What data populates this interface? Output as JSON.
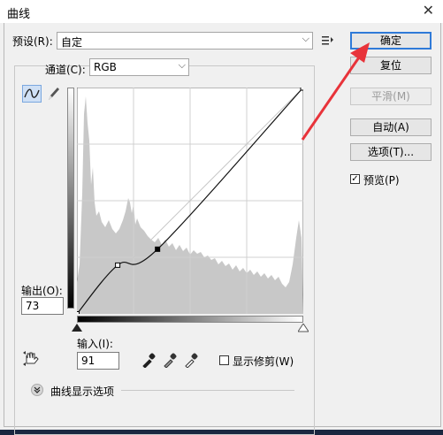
{
  "title": "曲线",
  "close_glyph": "✕",
  "preset": {
    "label": "预设(R):",
    "value": "自定"
  },
  "channel": {
    "label": "通道(C):",
    "value": "RGB"
  },
  "buttons": {
    "ok": "确定",
    "reset": "复位",
    "smooth": "平滑(M)",
    "auto": "自动(A)",
    "options": "选项(T)..."
  },
  "preview": {
    "label": "预览(P)",
    "checked": true
  },
  "output": {
    "label": "输出(O):",
    "value": "73"
  },
  "input": {
    "label": "输入(I):",
    "value": "91"
  },
  "show_clipping": {
    "label": "显示修剪(W)",
    "checked": false
  },
  "curve_display_options": "曲线显示选项",
  "colors": {
    "ok_border": "#2f7ad8",
    "arrow": "#e8333a",
    "histogram": "#c8c8c8"
  },
  "icons": [
    "menu-icon",
    "curve-tool-icon",
    "pencil-icon",
    "hand-adjust-icon",
    "black-eyedropper-icon",
    "gray-eyedropper-icon",
    "white-eyedropper-icon",
    "chevron-down-icon"
  ],
  "curve": {
    "input_range": [
      0,
      255
    ],
    "output_range": [
      0,
      255
    ],
    "points": [
      [
        0,
        0
      ],
      [
        46,
        55
      ],
      [
        91,
        73
      ],
      [
        255,
        255
      ]
    ]
  }
}
